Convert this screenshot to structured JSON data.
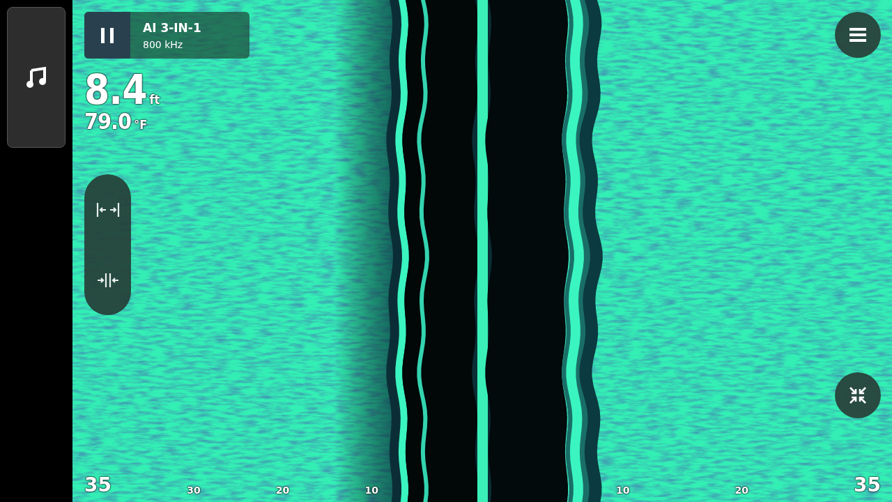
{
  "source": {
    "title": "AI 3-IN-1",
    "frequency": "800 kHz",
    "paused": true
  },
  "depth": {
    "value": "8.4",
    "unit": "ft"
  },
  "temperature": {
    "value": "79.0",
    "unit": "°F"
  },
  "range_scale": {
    "left": [
      {
        "label": "35",
        "kind": "range"
      },
      {
        "label": "30",
        "kind": "tick"
      },
      {
        "label": "20",
        "kind": "tick"
      },
      {
        "label": "10",
        "kind": "tick"
      }
    ],
    "right": [
      {
        "label": "10",
        "kind": "tick"
      },
      {
        "label": "20",
        "kind": "tick"
      },
      {
        "label": "35",
        "kind": "range"
      }
    ]
  }
}
